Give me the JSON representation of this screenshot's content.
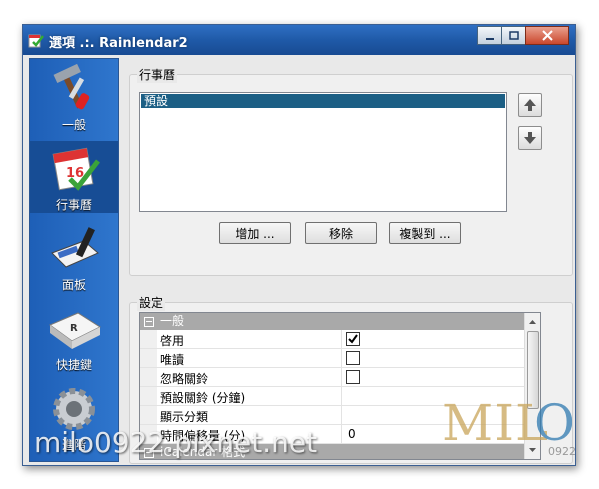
{
  "window": {
    "title": "選項 .:. Rainlendar2",
    "buttons": {
      "minimize": "minimize",
      "maximize": "maximize",
      "close": "close"
    }
  },
  "sidebar": {
    "items": [
      {
        "label": "一般",
        "icon": "hammer-screwdriver-icon",
        "selected": false
      },
      {
        "label": "行事曆",
        "icon": "calendar-check-icon",
        "selected": true
      },
      {
        "label": "面板",
        "icon": "panel-skin-icon",
        "selected": false
      },
      {
        "label": "快捷鍵",
        "icon": "keyboard-key-icon",
        "selected": false
      },
      {
        "label": "進階",
        "icon": "gear-icon",
        "selected": false
      }
    ]
  },
  "calendars": {
    "group_title": "行事曆",
    "list": [
      "預設"
    ],
    "buttons": {
      "add": "增加 ...",
      "remove": "移除",
      "copy": "複製到 ..."
    }
  },
  "settings": {
    "group_title": "設定",
    "categories": [
      {
        "name": "一般",
        "rows": [
          {
            "name": "啓用",
            "type": "checkbox",
            "checked": true
          },
          {
            "name": "唯讀",
            "type": "checkbox",
            "checked": false
          },
          {
            "name": "忽略關鈴",
            "type": "checkbox",
            "checked": false
          },
          {
            "name": "預設關鈴 (分鐘)",
            "type": "text",
            "value": ""
          },
          {
            "name": "顯示分類",
            "type": "text",
            "value": ""
          },
          {
            "name": "時間偏移量 (分)",
            "type": "text",
            "value": "0"
          }
        ]
      },
      {
        "name": "iCalendar 格式",
        "rows": []
      }
    ]
  },
  "overlay": {
    "watermark": "milo0922.pixnet.net",
    "logo": "MILO",
    "logo_sub": "0922"
  }
}
